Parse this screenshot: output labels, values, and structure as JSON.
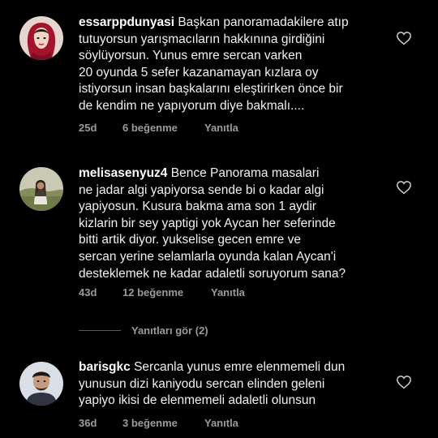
{
  "comments": [
    {
      "username": "essarppdunyasi",
      "text": " Başkan panoramadakilere atıp\ntutuyorsun yarışmacıların hakkınına girdiğini\nsöylüyorsun. Yunus emre sercan varken\n20 oyunda 5 sefer kazanamayan kızlara oy\nistiyorsun insan başkalarını eleştirirken önce bir\nde kendim ne yapıyorum diye bakmalı....",
      "time": "25d",
      "likes": "6 beğenme",
      "reply": "Yanıtla",
      "avatar_icon": "avatar-woman-headscarf"
    },
    {
      "username": "melisasenyuz4",
      "text": " Bence Panorama masalari\nne jadar algi yapiyorsa sende bi o kadar algi\nyapiyosun. Kusura bakma ama son 1 aydir\nkizlarin bir sey yaptigi yok Aycan her seferinde\nbitti artik diyor. yukselise gecen emre ve\nsercan yerine selamlarla oyunda kalan Aycan'i\ndesteklemek ne kadar adaletli soruyorum sana?",
      "time": "43d",
      "likes": "12 beğenme",
      "reply": "Yanıtla",
      "avatar_icon": "avatar-person-outdoor"
    },
    {
      "username": "barisgkc",
      "text": " Sercanla yunus emre elenmemeli dun\nyunusun dizi kaniyodu sercan elinden geleni\nyapiyo ikisi de elenmemeli adaletli olunsun",
      "time": "36d",
      "likes": "3 beğenme",
      "reply": "Yanıtla",
      "avatar_icon": "avatar-man"
    }
  ],
  "view_replies": "Yanıtları gör (2)",
  "icons": {
    "like": "heart-outline-icon"
  },
  "colors": {
    "background": "#000000",
    "text": "#f0f0f0",
    "meta": "#9a9a9a"
  }
}
